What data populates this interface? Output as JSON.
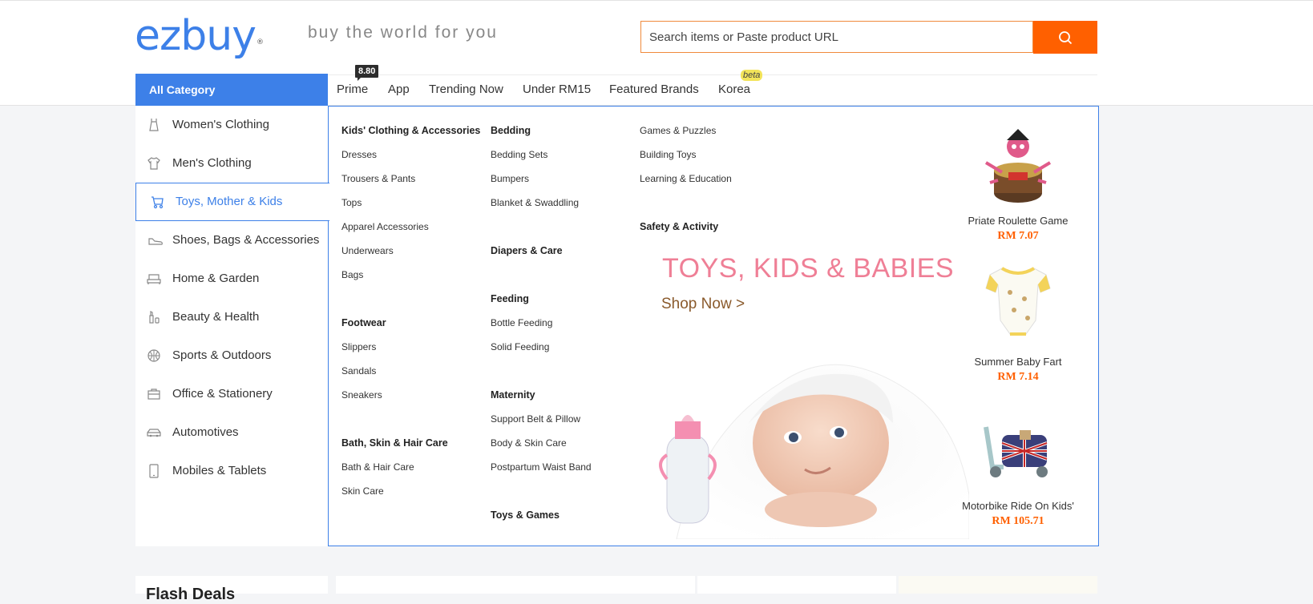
{
  "header": {
    "logo_text": "ezbuy",
    "logo_mark": "®",
    "tagline": "buy the world for you",
    "search": {
      "placeholder": "Search items or Paste product URL",
      "button_icon": "search-icon"
    }
  },
  "nav": {
    "all_category": "All Category",
    "items": [
      "Prime",
      "App",
      "Trending Now",
      "Under RM15",
      "Featured Brands",
      "Korea"
    ],
    "prime_badge": "8.80",
    "korea_badge": "beta"
  },
  "sidebar": {
    "items": [
      {
        "label": "Women's Clothing",
        "icon": "dress-icon"
      },
      {
        "label": "Men's Clothing",
        "icon": "shirt-icon"
      },
      {
        "label": "Toys, Mother & Kids",
        "icon": "stroller-icon",
        "active": true
      },
      {
        "label": "Shoes, Bags & Accessories",
        "icon": "shoe-icon"
      },
      {
        "label": "Home & Garden",
        "icon": "sofa-icon"
      },
      {
        "label": "Beauty & Health",
        "icon": "cosmetics-icon"
      },
      {
        "label": "Sports & Outdoors",
        "icon": "ball-icon"
      },
      {
        "label": "Office & Stationery",
        "icon": "briefcase-icon"
      },
      {
        "label": "Automotives",
        "icon": "car-icon"
      },
      {
        "label": "Mobiles & Tablets",
        "icon": "phone-icon"
      }
    ]
  },
  "panel": {
    "col1": {
      "groups": [
        {
          "title": "Kids' Clothing & Accessories",
          "links": [
            "Dresses",
            "Trousers & Pants",
            "Tops",
            "Apparel Accessories",
            "Underwears",
            "Bags"
          ]
        },
        {
          "title": "Footwear",
          "links": [
            "Slippers",
            "Sandals",
            "Sneakers"
          ]
        },
        {
          "title": "Bath, Skin & Hair Care",
          "links": [
            "Bath & Hair Care",
            "Skin Care"
          ]
        }
      ]
    },
    "col2": {
      "groups": [
        {
          "title": "Bedding",
          "links": [
            "Bedding Sets",
            "Bumpers",
            "Blanket & Swaddling"
          ]
        },
        {
          "title": "Diapers & Care",
          "links": []
        },
        {
          "title": "Feeding",
          "links": [
            "Bottle Feeding",
            "Solid Feeding"
          ]
        },
        {
          "title": "Maternity",
          "links": [
            "Support Belt & Pillow",
            "Body & Skin Care",
            "Postpartum Waist Band"
          ]
        },
        {
          "title": "Toys & Games",
          "links": []
        }
      ]
    },
    "col3": {
      "links": [
        "Games & Puzzles",
        "Building Toys",
        "Learning & Education"
      ],
      "title": "Safety & Activity"
    },
    "promo": {
      "title": "TOYS, KIDS & BABIES",
      "cta": "Shop Now >"
    },
    "products": [
      {
        "name": "Priate Roulette Game",
        "price": "RM 7.07"
      },
      {
        "name": "Summer Baby Fart",
        "price": "RM 7.14"
      },
      {
        "name": "Motorbike Ride On Kids'",
        "price": "RM 105.71"
      }
    ]
  },
  "bottom": {
    "flash_title": "Flash Deals"
  },
  "colors": {
    "brand_blue": "#3d80e8",
    "accent_orange": "#ff6000",
    "promo_pink": "#ef7f96"
  }
}
